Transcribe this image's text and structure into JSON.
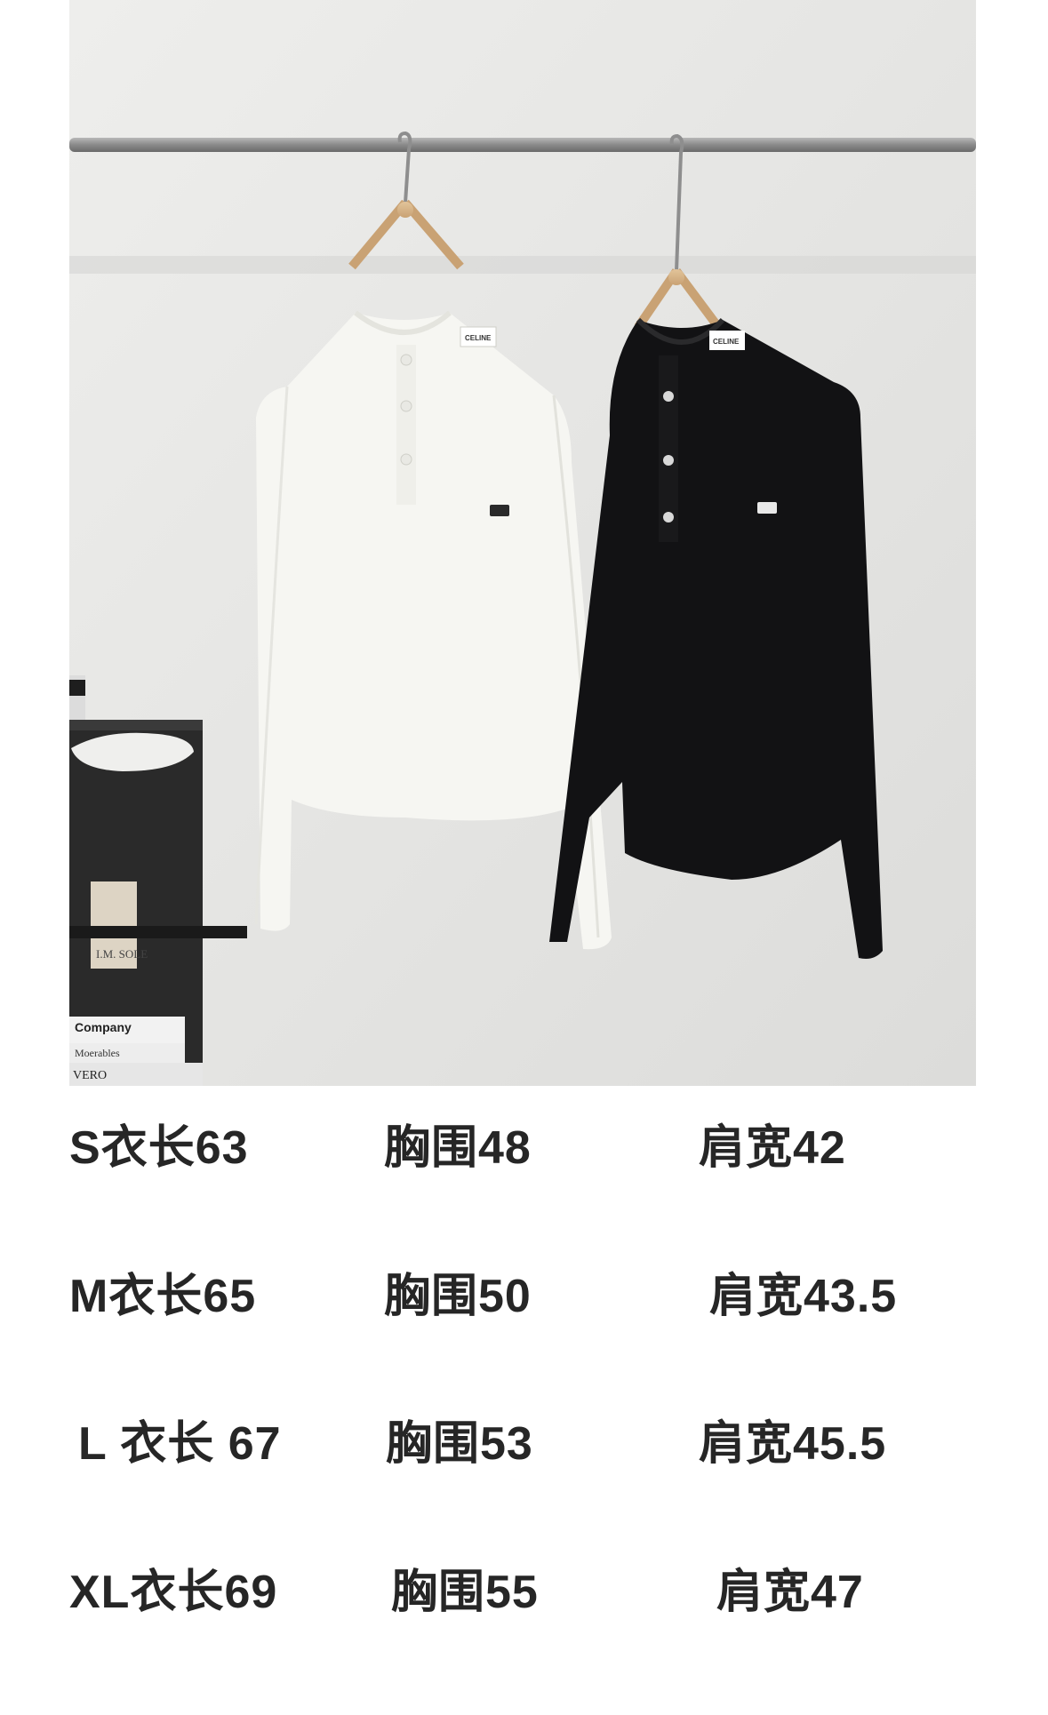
{
  "photo": {
    "subject": "white-and-black-henley-long-sleeve-shirts-on-hangers",
    "tag_text": "CELINE",
    "book_spines": [
      "Company",
      "Moerables",
      "VERO"
    ],
    "box_label": "I.M. SOLE"
  },
  "sizes": [
    {
      "size": "S",
      "length": "衣长63",
      "chest": "胸围48",
      "shoulder": "肩宽42"
    },
    {
      "size": "M",
      "length": "衣长65",
      "chest": "胸围50",
      "shoulder": "肩宽43.5"
    },
    {
      "size": "L",
      "length": "衣长 67",
      "chest": "胸围53",
      "shoulder": "肩宽45.5"
    },
    {
      "size": "XL",
      "length": "衣长69",
      "chest": "胸围55",
      "shoulder": "肩宽47"
    }
  ]
}
